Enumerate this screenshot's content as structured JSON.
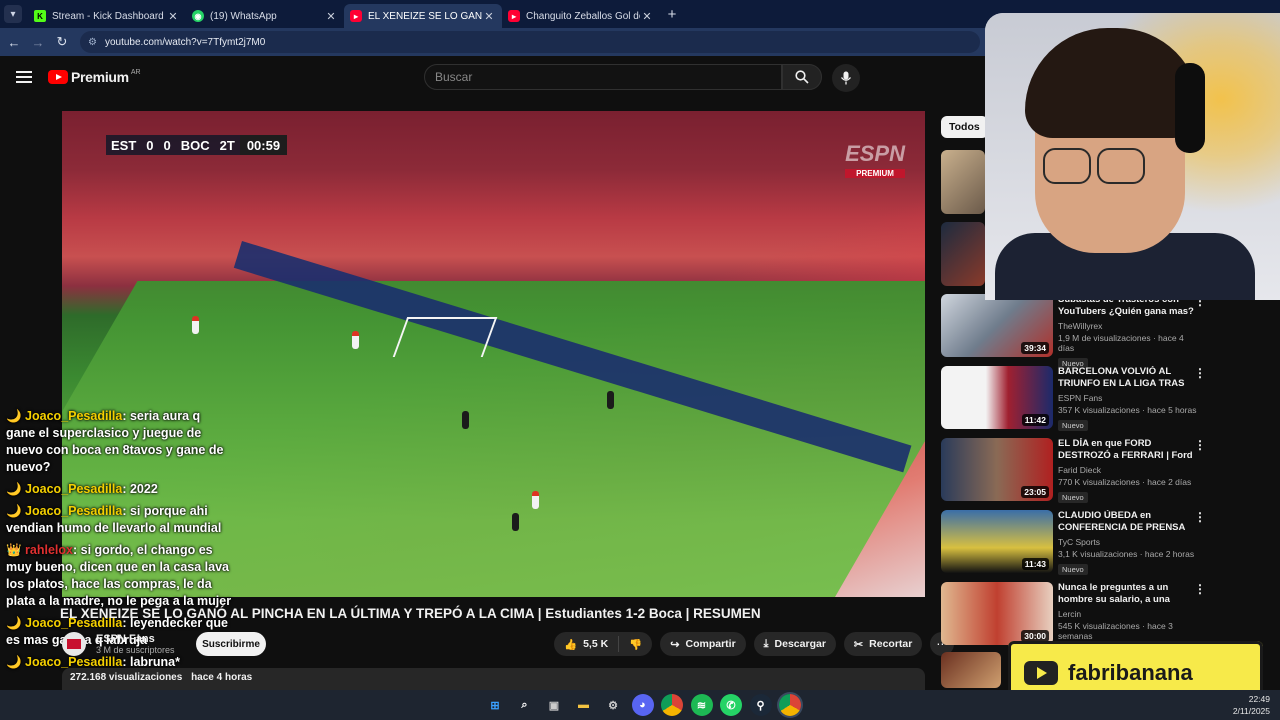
{
  "browser": {
    "tabs": [
      {
        "title": "Stream - Kick Dashboard",
        "icon": "kick-icon",
        "active": false
      },
      {
        "title": "(19) WhatsApp",
        "icon": "whatsapp-icon",
        "active": false
      },
      {
        "title": "EL XENEIZE SE LO GANÓ AL PIN",
        "icon": "youtube-icon",
        "active": true
      },
      {
        "title": "Changuito Zeballos Gol de tiro",
        "icon": "youtube-icon",
        "active": false
      }
    ],
    "url": "youtube.com/watch?v=7Tfymt2j7M0"
  },
  "youtube": {
    "logo_text": "Premium",
    "country_code": "AR",
    "search_placeholder": "Buscar",
    "filter_chip": "Todos"
  },
  "video": {
    "scorebug": {
      "home": "EST",
      "home_score": "0",
      "away_score": "0",
      "away": "BOC",
      "period": "2T",
      "clock": "00:59"
    },
    "broadcaster": "ESPN",
    "broadcaster_tag": "PREMIUM",
    "title": "EL XENEIZE SE LO GANÓ AL PINCHA EN LA ÚLTIMA Y TREPÓ A LA CIMA | Estudiantes 1-2 Boca | RESUMEN",
    "channel": "ESPN Fans",
    "subscribers": "3 M de suscriptores",
    "subscribe_label": "Suscribirme",
    "likes": "5,5 K",
    "share_label": "Compartir",
    "download_label": "Descargar",
    "clip_label": "Recortar",
    "views": "272.168 visualizaciones",
    "age": "hace 4 horas"
  },
  "chat": [
    {
      "user": "Joaco_Pesadilla",
      "text": "seria aura q gane el superclasico y juegue de nuevo con boca en 8tavos y gane de nuevo?"
    },
    {
      "user": "Joaco_Pesadilla",
      "text": "2022"
    },
    {
      "user": "Joaco_Pesadilla",
      "text": "si porque ahi vendian humo de llevarlo al mundial"
    },
    {
      "user": "rahlelox",
      "text": "si gordo, el chango es muy bueno, dicen que en la casa lava los platos, hace las compras, le da plata a la madre, no le pega a la mujer"
    },
    {
      "user": "Joaco_Pesadilla",
      "text": "leyendecker que es mas gallina q labruja"
    },
    {
      "user": "Joaco_Pesadilla",
      "text": "labruna*"
    }
  ],
  "related": [
    {
      "title": "Subastas de Trasteros con YouTubers ¿Quién gana mas?",
      "channel": "TheWillyrex",
      "stats": "1,9 M de visualizaciones · hace 4 días",
      "badge": "Nuevo",
      "duration": "39:34"
    },
    {
      "title": "BARCELONA VOLVIÓ AL TRIUNFO EN LA LIGA TRAS LA...",
      "channel": "ESPN Fans",
      "stats": "357 K visualizaciones · hace 5 horas",
      "badge": "Nuevo",
      "duration": "11:42"
    },
    {
      "title": "EL DÍA en que FORD DESTROZÓ a FERRARI | Ford vs Ferrari | ...",
      "channel": "Farid Dieck",
      "stats": "770 K visualizaciones · hace 2 días",
      "badge": "Nuevo",
      "duration": "23:05"
    },
    {
      "title": "CLAUDIO ÚBEDA en CONFERENCIA DE PRENSA tra...",
      "channel": "TyC Sports",
      "stats": "3,1 K visualizaciones · hace 2 horas",
      "badge": "Nuevo",
      "duration": "11:43"
    },
    {
      "title": "Nunca le preguntes a un hombre su salario, a una muje...",
      "channel": "Lercin",
      "stats": "545 K visualizaciones · hace 3 semanas",
      "badge": "",
      "duration": "30:00"
    }
  ],
  "overlay": {
    "streamer_name": "fabribanana"
  },
  "taskbar": {
    "time": "22:49",
    "date": "2/11/2025"
  }
}
